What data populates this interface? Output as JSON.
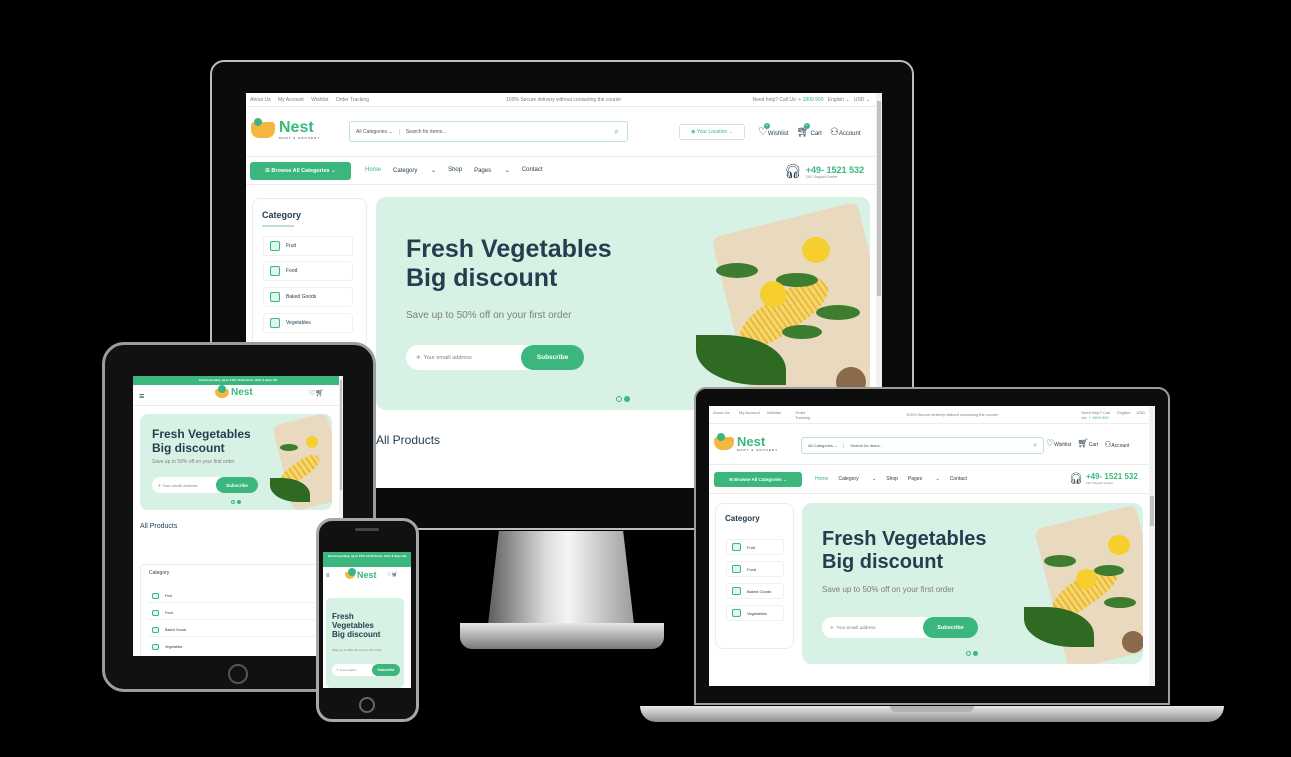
{
  "colors": {
    "brand": "#3bb77e",
    "banner_bg": "#d8f1e5",
    "text": "#253d4e"
  },
  "topbar": {
    "links": [
      "About Us",
      "My Account",
      "Wishlist",
      "Order Tracking"
    ],
    "promo": "100% Secure delivery without contacting the courier",
    "help": "Need help? Call Us: ",
    "help_number": "+ 1800 900",
    "language": "English",
    "currency": "USD"
  },
  "laptop_topbar": {
    "links": [
      "About Us",
      "My Account",
      "Wishlist",
      "Order Tracking"
    ],
    "help": "Need help? Call Us:",
    "help_number": "+ 1800 900"
  },
  "logo": {
    "name": "Nest",
    "tagline": "MART & GROCERY"
  },
  "search": {
    "category": "All Categories",
    "placeholder": "Search for items..."
  },
  "location": "Your Location",
  "header_actions": {
    "wishlist": "Wishlist",
    "cart": "Cart",
    "account": "Account",
    "wishlist_count": "0",
    "cart_count": "0"
  },
  "browse_button": "Browse All Categories",
  "nav": [
    "Home",
    "Category",
    "Shop",
    "Pages",
    "Contact"
  ],
  "support": {
    "number": "+49- 1521 532",
    "label": "24/7 Support Center"
  },
  "sidebar": {
    "title": "Category",
    "items": [
      "Fruit",
      "Food",
      "Baked Goods",
      "Vegetables"
    ]
  },
  "banner": {
    "title_line1": "Fresh Vegetables",
    "title_line2": "Big discount",
    "subtitle": "Save up to 50% off on your first order",
    "email_placeholder": "Your emaill address",
    "subscribe": "Subscribe"
  },
  "all_products": "All Products",
  "mobile_strip": "Grand opening, up to 15% off all items. Only 3 days left",
  "phone_banner": {
    "l1": "Fresh",
    "l2": "Vegetables",
    "l3": "Big discount",
    "subtitle": "Save up to 50% off on your first order",
    "email_placeholder": "Your emaill a",
    "subscribe": "Subscribe"
  }
}
